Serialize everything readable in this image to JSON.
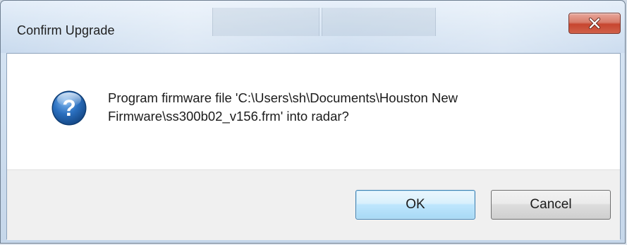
{
  "window": {
    "title": "Confirm Upgrade"
  },
  "icons": {
    "close": "close-icon",
    "message": "question-icon"
  },
  "message": {
    "line1": "Program firmware file 'C:\\Users\\sh\\Documents\\Houston New",
    "line2": "Firmware\\ss300b02_v156.frm' into radar?"
  },
  "buttons": {
    "ok": "OK",
    "cancel": "Cancel"
  },
  "colors": {
    "close_button": "#c7452f",
    "default_button_border": "#3c7fb1",
    "question_icon": "#1d5fa8"
  }
}
